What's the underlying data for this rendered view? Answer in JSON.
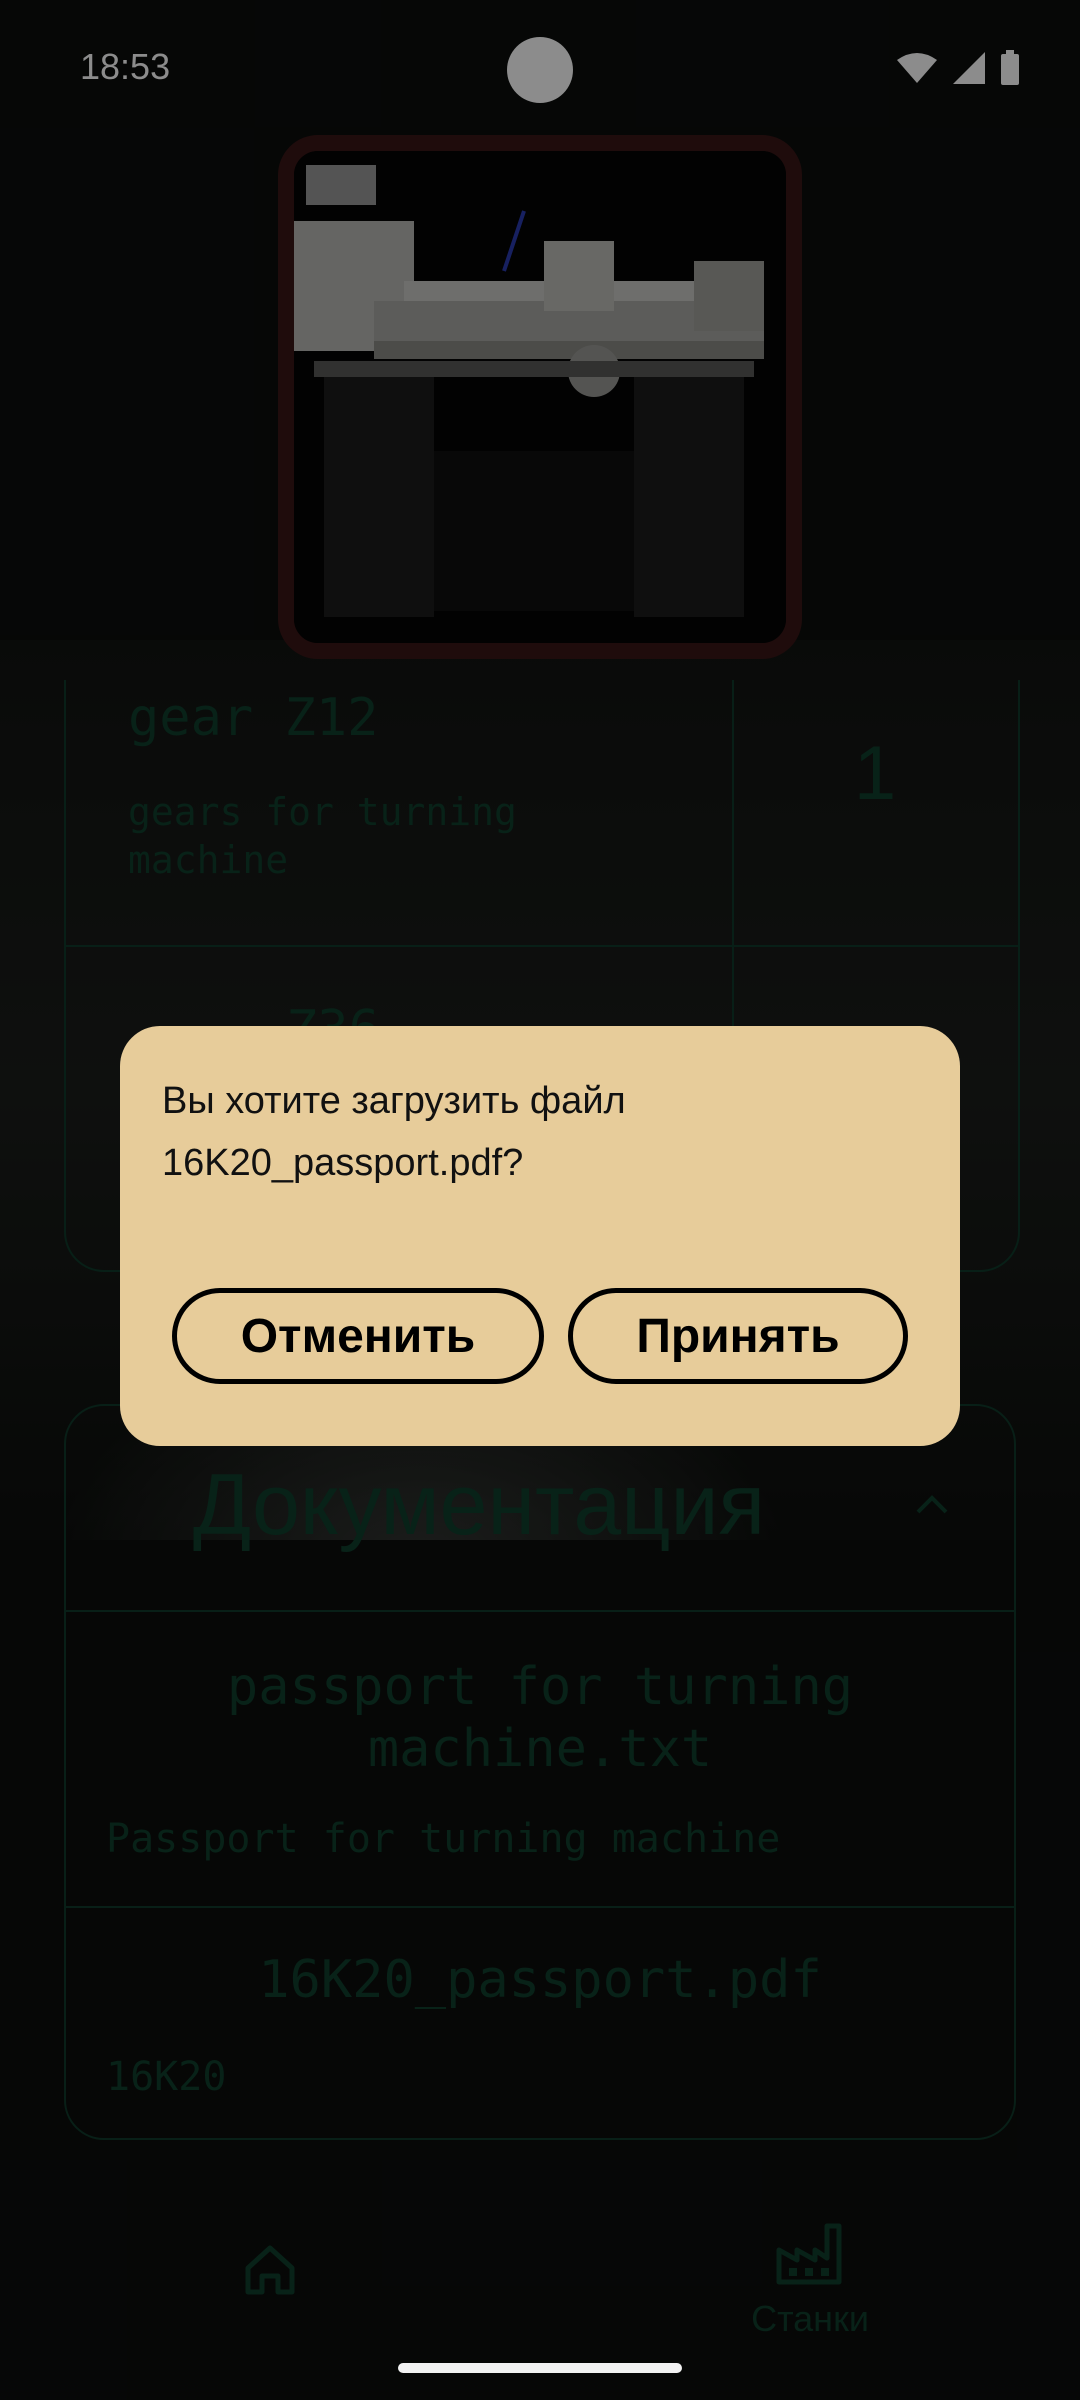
{
  "status_bar": {
    "time": "18:53"
  },
  "parts_table": {
    "rows": [
      {
        "name": "gear Z12",
        "description": "gears for turning machine",
        "quantity": "1"
      },
      {
        "name": "Z36"
      }
    ]
  },
  "documentation": {
    "title": "Документация",
    "documents": [
      {
        "title": "passport for turning machine.txt",
        "description": "Passport for turning machine"
      },
      {
        "title": "16K20_passport.pdf",
        "description": "16K20"
      }
    ]
  },
  "bottom_nav": {
    "machines_label": "Станки"
  },
  "dialog": {
    "message": "Вы хотите загрузить файл 16K20_passport.pdf?",
    "cancel_label": "Отменить",
    "accept_label": "Принять"
  },
  "colors": {
    "dialog_bg": "#e7cc9a",
    "muted_green": "#0f3e2c",
    "photo_frame": "#3a1616"
  }
}
